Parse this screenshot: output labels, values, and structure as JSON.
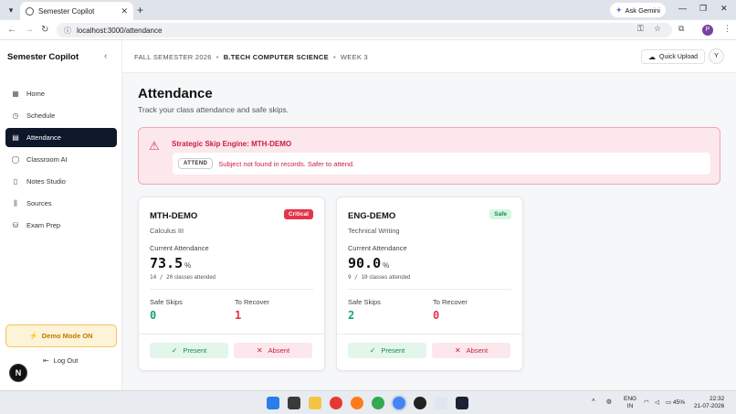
{
  "browser": {
    "tab_title": "Semester Copilot",
    "tab_close": "✕",
    "new_tab": "+",
    "ask_gemini": "Ask Gemini",
    "url": "localhost:3000/attendance",
    "profile_initial": "P"
  },
  "sidebar": {
    "brand": "Semester Copilot",
    "items": [
      {
        "label": "Home",
        "icon": "grid-icon"
      },
      {
        "label": "Schedule",
        "icon": "clock-icon"
      },
      {
        "label": "Attendance",
        "icon": "calendar-icon"
      },
      {
        "label": "Classroom AI",
        "icon": "chat-icon"
      },
      {
        "label": "Notes Studio",
        "icon": "book-icon"
      },
      {
        "label": "Sources",
        "icon": "library-icon"
      },
      {
        "label": "Exam Prep",
        "icon": "database-icon"
      }
    ],
    "demo_mode": "Demo Mode ON",
    "logout": "Log Out",
    "avatar_letter": "N"
  },
  "topbar": {
    "semester": "FALL SEMESTER 2026",
    "program": "B.TECH COMPUTER SCIENCE",
    "week": "WEEK 3",
    "quick_upload": "Quick Upload",
    "user_initial": "Y"
  },
  "page": {
    "title": "Attendance",
    "subtitle": "Track your class attendance and safe skips."
  },
  "alert": {
    "title": "Strategic Skip Engine: MTH-DEMO",
    "pill": "ATTEND",
    "message": "Subject not found in records. Safer to attend."
  },
  "labels": {
    "current_attendance": "Current Attendance",
    "classes_attended": "classes attended",
    "safe_skips": "Safe Skips",
    "to_recover": "To Recover",
    "present": "Present",
    "absent": "Absent",
    "pct_unit": "%"
  },
  "courses": [
    {
      "code": "MTH-DEMO",
      "name": "Calculus III",
      "badge": "Critical",
      "percent": "73.5",
      "attended": "14 / 20",
      "safe_skips": "0",
      "to_recover": "1"
    },
    {
      "code": "ENG-DEMO",
      "name": "Technical Writing",
      "badge": "Safe",
      "percent": "90.0",
      "attended": "9 / 10",
      "safe_skips": "2",
      "to_recover": "0"
    }
  ],
  "system": {
    "lang": "ENG",
    "region": "IN",
    "battery": "45%",
    "time": "22:32",
    "date": "21-07-2026"
  },
  "colors": {
    "accent_dark": "#0f172a",
    "danger": "#e5344a",
    "success": "#1aa36a",
    "warning": "#f2c35f"
  }
}
